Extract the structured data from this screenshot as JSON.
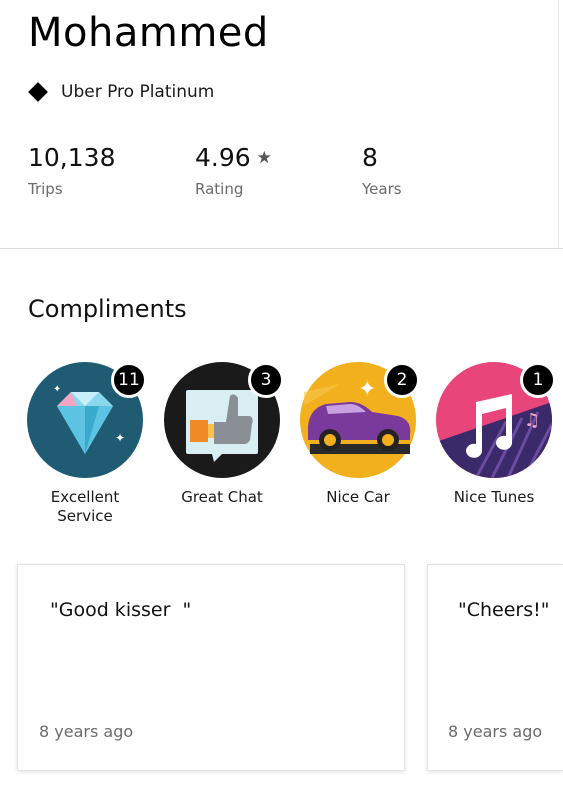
{
  "profile": {
    "name": "Mohammed",
    "tier_label": "Uber Pro Platinum",
    "tier_icon": "diamond-icon"
  },
  "stats": [
    {
      "value": "10,138",
      "label": "Trips"
    },
    {
      "value": "4.96",
      "label": "Rating",
      "icon": "star-icon",
      "icon_glyph": "★"
    },
    {
      "value": "8",
      "label": "Years"
    }
  ],
  "compliments": {
    "title": "Compliments",
    "items": [
      {
        "label": "Excellent\nService",
        "count": "11",
        "icon": "diamond-badge-icon",
        "bg": "#1f5c73"
      },
      {
        "label": "Great Chat",
        "count": "3",
        "icon": "thumbs-up-chat-icon",
        "bg": "#1a1a1a"
      },
      {
        "label": "Nice Car",
        "count": "2",
        "icon": "purple-car-icon",
        "bg": "#f2b01e"
      },
      {
        "label": "Nice Tunes",
        "count": "1",
        "icon": "music-note-icon",
        "bg": "#e8457a"
      }
    ]
  },
  "comment_cards": [
    {
      "quote": "\"Good kisser  \"",
      "time": "8 years ago"
    },
    {
      "quote": "\"Cheers!\"",
      "time": "8 years ago"
    }
  ]
}
